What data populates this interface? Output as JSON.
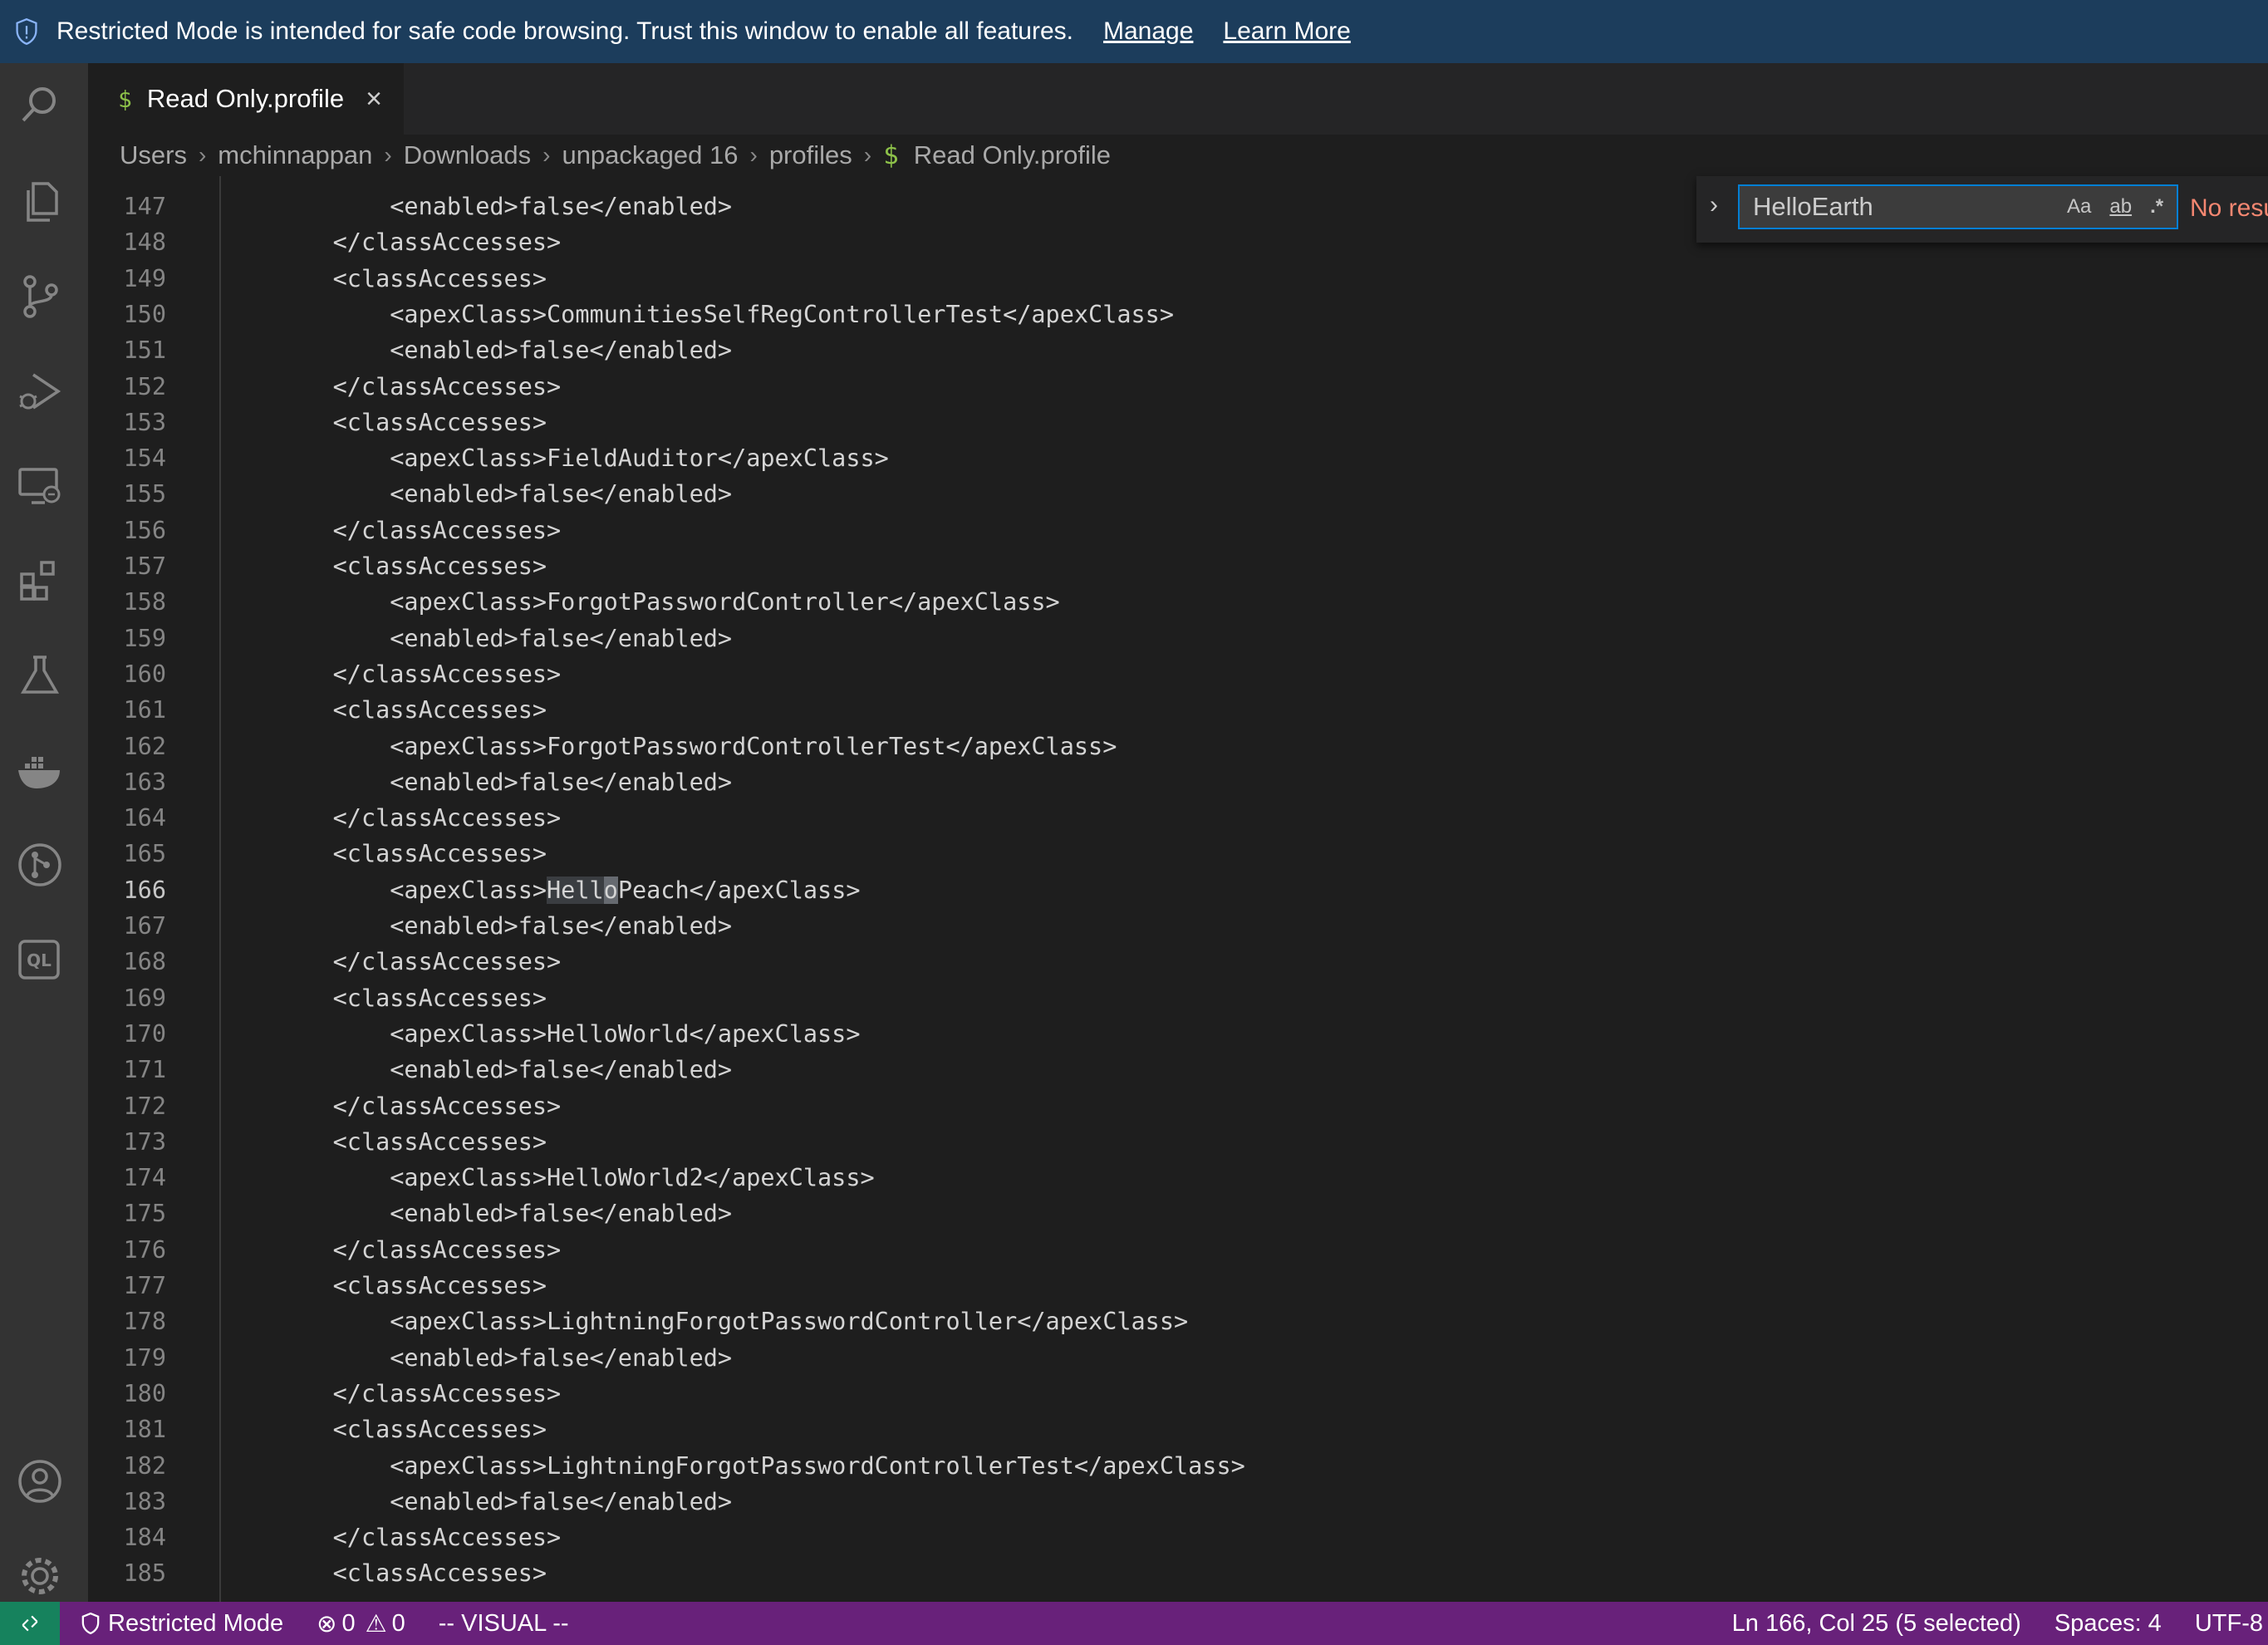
{
  "banner": {
    "message": "Restricted Mode is intended for safe code browsing. Trust this window to enable all features.",
    "manage_link": "Manage",
    "learn_more_link": "Learn More"
  },
  "activity_bar": {
    "icons": [
      "search-icon",
      "explorer-icon",
      "source-control-icon",
      "run-debug-icon",
      "remote-explorer-icon",
      "extensions-icon",
      "testing-icon",
      "docker-icon",
      "git-graph-icon",
      "codeql-icon",
      "account-icon",
      "settings-gear-icon"
    ],
    "codeql_label": "QL"
  },
  "tab": {
    "icon_glyph": "$",
    "title": "Read Only.profile",
    "close_glyph": "×"
  },
  "breadcrumb": {
    "parts": [
      "Users",
      "mchinnappan",
      "Downloads",
      "unpackaged 16",
      "profiles"
    ],
    "file_icon_glyph": "$",
    "file": "Read Only.profile",
    "separator": "›"
  },
  "editor": {
    "active_line": 166,
    "lines": [
      {
        "n": "147",
        "text": "        <enabled>false</enabled>"
      },
      {
        "n": "148",
        "text": "    </classAccesses>"
      },
      {
        "n": "149",
        "text": "    <classAccesses>"
      },
      {
        "n": "150",
        "text": "        <apexClass>CommunitiesSelfRegControllerTest</apexClass>"
      },
      {
        "n": "151",
        "text": "        <enabled>false</enabled>"
      },
      {
        "n": "152",
        "text": "    </classAccesses>"
      },
      {
        "n": "153",
        "text": "    <classAccesses>"
      },
      {
        "n": "154",
        "text": "        <apexClass>FieldAuditor</apexClass>"
      },
      {
        "n": "155",
        "text": "        <enabled>false</enabled>"
      },
      {
        "n": "156",
        "text": "    </classAccesses>"
      },
      {
        "n": "157",
        "text": "    <classAccesses>"
      },
      {
        "n": "158",
        "text": "        <apexClass>ForgotPasswordController</apexClass>"
      },
      {
        "n": "159",
        "text": "        <enabled>false</enabled>"
      },
      {
        "n": "160",
        "text": "    </classAccesses>"
      },
      {
        "n": "161",
        "text": "    <classAccesses>"
      },
      {
        "n": "162",
        "text": "        <apexClass>ForgotPasswordControllerTest</apexClass>"
      },
      {
        "n": "163",
        "text": "        <enabled>false</enabled>"
      },
      {
        "n": "164",
        "text": "    </classAccesses>"
      },
      {
        "n": "165",
        "text": "    <classAccesses>"
      },
      {
        "n": "166",
        "pre": "        <apexClass>",
        "sel": "Hell",
        "cur": "o",
        "post": "Peach</apexClass>"
      },
      {
        "n": "167",
        "text": "        <enabled>false</enabled>"
      },
      {
        "n": "168",
        "text": "    </classAccesses>"
      },
      {
        "n": "169",
        "text": "    <classAccesses>"
      },
      {
        "n": "170",
        "text": "        <apexClass>HelloWorld</apexClass>"
      },
      {
        "n": "171",
        "text": "        <enabled>false</enabled>"
      },
      {
        "n": "172",
        "text": "    </classAccesses>"
      },
      {
        "n": "173",
        "text": "    <classAccesses>"
      },
      {
        "n": "174",
        "text": "        <apexClass>HelloWorld2</apexClass>"
      },
      {
        "n": "175",
        "text": "        <enabled>false</enabled>"
      },
      {
        "n": "176",
        "text": "    </classAccesses>"
      },
      {
        "n": "177",
        "text": "    <classAccesses>"
      },
      {
        "n": "178",
        "text": "        <apexClass>LightningForgotPasswordController</apexClass>"
      },
      {
        "n": "179",
        "text": "        <enabled>false</enabled>"
      },
      {
        "n": "180",
        "text": "    </classAccesses>"
      },
      {
        "n": "181",
        "text": "    <classAccesses>"
      },
      {
        "n": "182",
        "text": "        <apexClass>LightningForgotPasswordControllerTest</apexClass>"
      },
      {
        "n": "183",
        "text": "        <enabled>false</enabled>"
      },
      {
        "n": "184",
        "text": "    </classAccesses>"
      },
      {
        "n": "185",
        "text": "    <classAccesses>"
      }
    ]
  },
  "find_widget": {
    "toggle_glyph": "›",
    "query": "HelloEarth",
    "match_case_label": "Aa",
    "whole_word_label": "ab",
    "regex_label": ".*",
    "result_text": "No resu"
  },
  "status_bar": {
    "remote_glyph": "><",
    "restricted_mode": "Restricted Mode",
    "errors": "0",
    "warnings": "0",
    "vim_mode": "-- VISUAL --",
    "cursor_position": "Ln 166, Col 25 (5 selected)",
    "indentation": "Spaces: 4",
    "encoding": "UTF-8",
    "colors": {
      "background": "#68217a",
      "remote": "#16825d"
    }
  }
}
